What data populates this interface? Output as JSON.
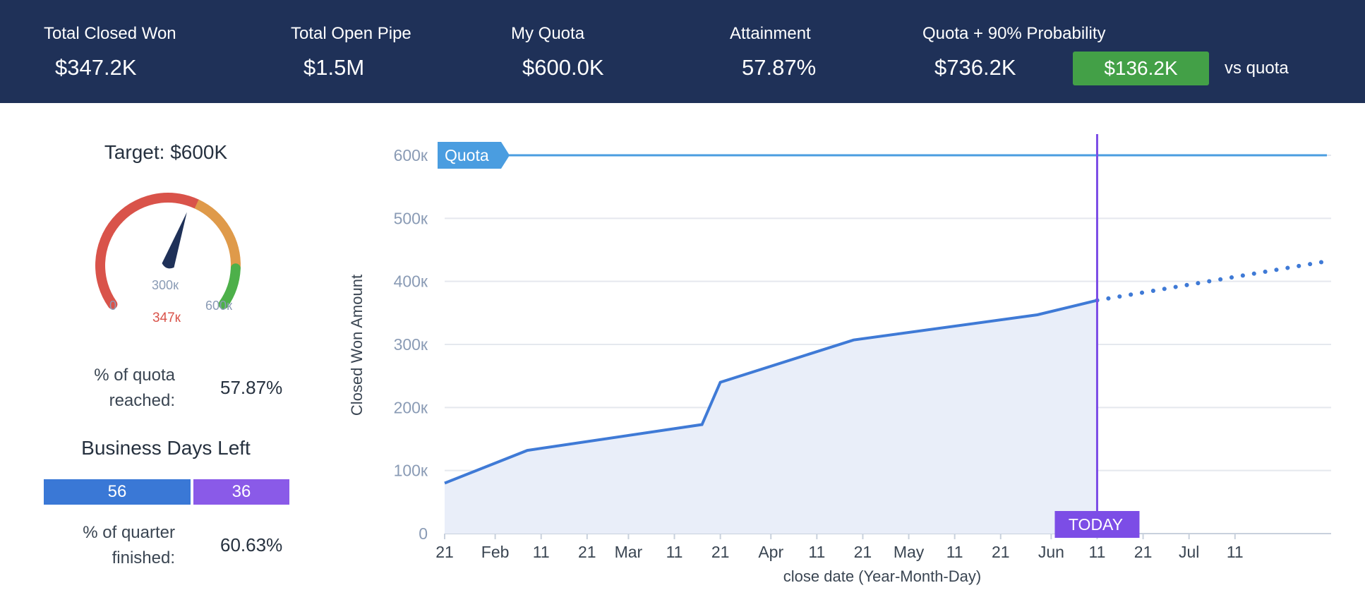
{
  "kpis": [
    {
      "label": "Total Closed Won",
      "value": "$347.2K"
    },
    {
      "label": "Total Open Pipe",
      "value": "$1.5M"
    },
    {
      "label": "My Quota",
      "value": "$600.0K"
    },
    {
      "label": "Attainment",
      "value": "57.87%"
    },
    {
      "label": "Quota + 90% Probability",
      "value": "$736.2K"
    }
  ],
  "kpi_badge": {
    "value": "$136.2K",
    "note": "vs quota"
  },
  "gauge": {
    "title": "Target: $600K",
    "min_label": "0",
    "mid_label": "300к",
    "max_label": "600к",
    "current_label": "347к",
    "current_value": 347,
    "max_value": 600
  },
  "quota_stats": {
    "label_line1": "% of quota",
    "label_line2": "reached:",
    "value": "57.87%"
  },
  "business_days": {
    "title": "Business Days Left",
    "elapsed": "56",
    "left": "36"
  },
  "quarter_stats": {
    "label_line1": "% of quarter",
    "label_line2": "finished:",
    "value": "60.63%"
  },
  "chart_data": {
    "type": "area",
    "xlabel": "close date (Year-Month-Day)",
    "ylabel": "Closed Won Amount",
    "ylim": [
      0,
      600000
    ],
    "yticks": [
      {
        "value": 0,
        "label": "0"
      },
      {
        "value": 100000,
        "label": "100к"
      },
      {
        "value": 200000,
        "label": "200к"
      },
      {
        "value": 300000,
        "label": "300к"
      },
      {
        "value": 400000,
        "label": "400к"
      },
      {
        "value": 500000,
        "label": "500к"
      },
      {
        "value": 600000,
        "label": "600к"
      }
    ],
    "xlim": [
      "2020-01-21",
      "2020-07-31"
    ],
    "xticks": [
      {
        "date": "2020-01-21",
        "label": "21"
      },
      {
        "date": "2020-02-01",
        "label": "Feb"
      },
      {
        "date": "2020-02-11",
        "label": "11"
      },
      {
        "date": "2020-02-21",
        "label": "21"
      },
      {
        "date": "2020-03-01",
        "label": "Mar"
      },
      {
        "date": "2020-03-11",
        "label": "11"
      },
      {
        "date": "2020-03-21",
        "label": "21"
      },
      {
        "date": "2020-04-01",
        "label": "Apr"
      },
      {
        "date": "2020-04-11",
        "label": "11"
      },
      {
        "date": "2020-04-21",
        "label": "21"
      },
      {
        "date": "2020-05-01",
        "label": "May"
      },
      {
        "date": "2020-05-11",
        "label": "11"
      },
      {
        "date": "2020-05-21",
        "label": "21"
      },
      {
        "date": "2020-06-01",
        "label": "Jun"
      },
      {
        "date": "2020-06-11",
        "label": "11"
      },
      {
        "date": "2020-06-21",
        "label": "21"
      },
      {
        "date": "2020-07-01",
        "label": "Jul"
      },
      {
        "date": "2020-07-11",
        "label": "11"
      }
    ],
    "series": [
      {
        "style": "solid-area",
        "points": [
          {
            "x": "2020-01-21",
            "y": 80000
          },
          {
            "x": "2020-02-08",
            "y": 132000
          },
          {
            "x": "2020-03-17",
            "y": 173000
          },
          {
            "x": "2020-03-21",
            "y": 240000
          },
          {
            "x": "2020-04-19",
            "y": 307000
          },
          {
            "x": "2020-05-29",
            "y": 347000
          },
          {
            "x": "2020-06-11",
            "y": 370000
          }
        ]
      },
      {
        "style": "dotted",
        "points": [
          {
            "x": "2020-06-11",
            "y": 370000
          },
          {
            "x": "2020-07-31",
            "y": 432000
          }
        ]
      }
    ],
    "quota": {
      "label": "Quota",
      "value": 600000
    },
    "today": {
      "label": "TODAY",
      "date": "2020-06-11"
    },
    "grid": true,
    "colors": {
      "line": "#3f7ad6",
      "area": "#e9eef9",
      "quota": "#4a9de0",
      "today": "#7c4de6",
      "grid": "#e5e8ee",
      "tick": "#8a9bb5"
    }
  },
  "colors": {
    "header": "#1f3158",
    "badge": "#43a047",
    "gauge_red": "#d9534a",
    "gauge_orange": "#df9a4a",
    "gauge_green": "#4db04a",
    "needle": "#1f3158",
    "bar_elapsed": "#3a78d6",
    "bar_left": "#8a5ae8"
  }
}
